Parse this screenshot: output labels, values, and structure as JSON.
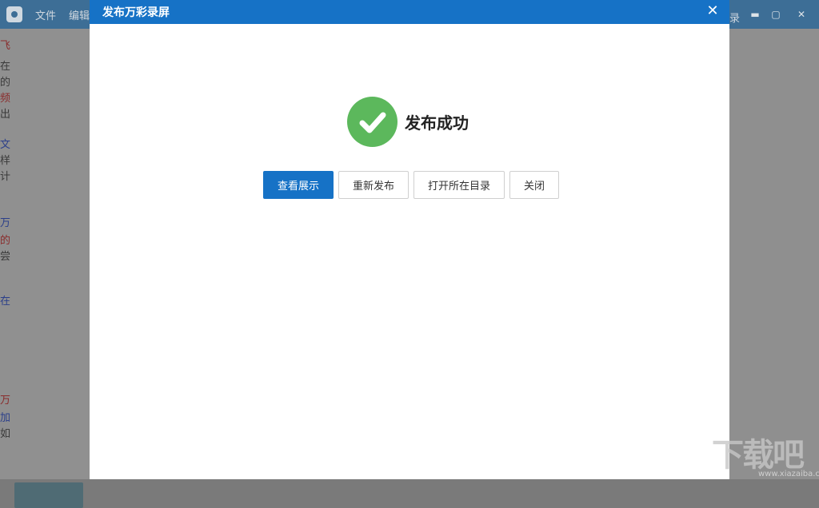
{
  "background_app": {
    "menu": [
      "文件",
      "编辑"
    ],
    "right_text": "录",
    "window_controls": [
      "minimize-icon",
      "maximize-icon",
      "close-icon"
    ],
    "fragments": [
      {
        "text": "飞",
        "color": "red"
      },
      {
        "text": "在",
        "color": "normal"
      },
      {
        "text": "的",
        "color": "normal"
      },
      {
        "text": "频",
        "color": "red"
      },
      {
        "text": "出",
        "color": "normal"
      },
      {
        "text": "文",
        "color": "blue"
      },
      {
        "text": "样",
        "color": "normal"
      },
      {
        "text": "计",
        "color": "normal"
      },
      {
        "text": "万",
        "color": "blue"
      },
      {
        "text": "的",
        "color": "red"
      },
      {
        "text": "尝",
        "color": "normal"
      },
      {
        "text": "在",
        "color": "blue"
      },
      {
        "text": "万",
        "color": "red"
      },
      {
        "text": "加",
        "color": "blue"
      },
      {
        "text": "如",
        "color": "normal"
      }
    ]
  },
  "dialog": {
    "title": "发布万彩录屏",
    "success_text": "发布成功",
    "buttons": {
      "view": "查看展示",
      "republish": "重新发布",
      "open_dir": "打开所在目录",
      "close": "关闭"
    }
  },
  "watermark": {
    "text": "下载吧",
    "sub": "www.xiazaiba.com"
  }
}
